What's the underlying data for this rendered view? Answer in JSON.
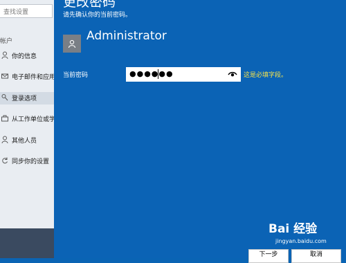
{
  "sidebar": {
    "search_placeholder": "查找设置",
    "section_label": "帐户",
    "items": [
      {
        "label": "你的信息",
        "icon": "person-icon",
        "active": false
      },
      {
        "label": "电子邮件和应用",
        "icon": "mail-icon",
        "active": false
      },
      {
        "label": "登录选项",
        "icon": "key-icon",
        "active": true
      },
      {
        "label": "从工作单位或学",
        "icon": "briefcase-icon",
        "active": false
      },
      {
        "label": "其他人员",
        "icon": "people-icon",
        "active": false
      },
      {
        "label": "同步你的设置",
        "icon": "sync-icon",
        "active": false
      }
    ]
  },
  "dialog": {
    "title": "更改密码",
    "subtitle": "请先确认你的当前密码。",
    "username": "Administrator",
    "password_label": "当前密码",
    "password_value": "●●●●●●",
    "required_message": "这是必填字段。",
    "next_button": "下一步",
    "cancel_button": "取消"
  },
  "watermark": {
    "main": "Bai 经验",
    "sub": "jingyan.baidu.com"
  },
  "colors": {
    "dialog_bg": "#0b63b5",
    "required_text": "#f4e24c",
    "sidebar_bg": "#e9edf2"
  }
}
